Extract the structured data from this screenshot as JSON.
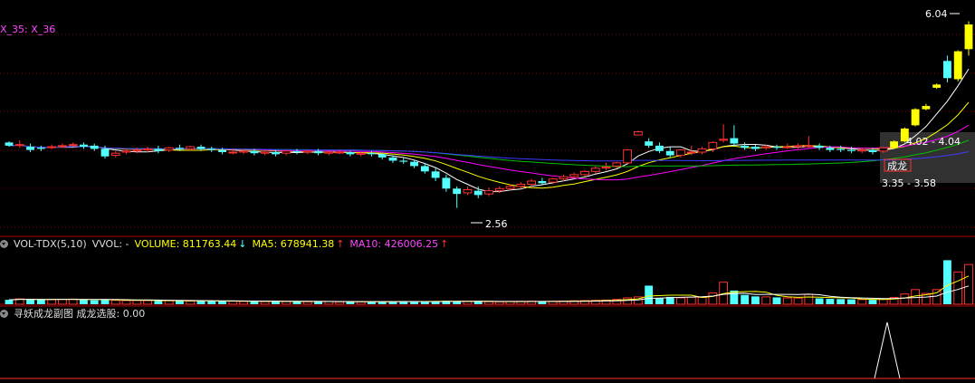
{
  "colors": {
    "background": "#000000",
    "up": "#ff3232",
    "down": "#54ffff",
    "ma_yellow": "#ffff00",
    "ma_white": "#ffffff",
    "ma_magenta": "#ff00ff",
    "ma_green": "#00c000",
    "ma_blue": "#3b3bff",
    "grid": "#7a0000",
    "highlight_band": "#505050"
  },
  "main_panel": {
    "legend": "X_35: X_36",
    "annotations": {
      "high_price": "6.04",
      "low_price": "2.56",
      "upper_zone": "4.02 - 4.04",
      "lower_zone": "3.35 - 3.58",
      "signal_label": "成龙"
    }
  },
  "volume_panel": {
    "indicator": "VOL-TDX(5,10)",
    "vvol": "VVOL: -",
    "volume": "VOLUME: 811763.44",
    "volume_arrow": "↓",
    "ma5": "MA5: 678941.38",
    "ma5_arrow": "↑",
    "ma10": "MA10: 426006.25",
    "ma10_arrow": "↑"
  },
  "signal_panel": {
    "title": "寻妖成龙副图 成龙选股: 0.00"
  },
  "chart_data": [
    {
      "type": "candlestick",
      "title": "",
      "ylim": [
        2.3,
        6.2
      ],
      "series": [
        {
          "values": [
            [
              3.78,
              3.8,
              3.72,
              3.7
            ],
            [
              3.74,
              3.82,
              3.74,
              3.68
            ],
            [
              3.7,
              3.76,
              3.64,
              3.6
            ],
            [
              3.68,
              3.72,
              3.66,
              3.62
            ],
            [
              3.7,
              3.74,
              3.7,
              3.66
            ],
            [
              3.72,
              3.76,
              3.72,
              3.68
            ],
            [
              3.74,
              3.78,
              3.74,
              3.7
            ],
            [
              3.74,
              3.78,
              3.7,
              3.66
            ],
            [
              3.72,
              3.76,
              3.66,
              3.62
            ],
            [
              3.66,
              3.72,
              3.52,
              3.48
            ],
            [
              3.54,
              3.62,
              3.58,
              3.5
            ],
            [
              3.6,
              3.66,
              3.62,
              3.56
            ],
            [
              3.62,
              3.68,
              3.64,
              3.58
            ],
            [
              3.64,
              3.7,
              3.66,
              3.6
            ],
            [
              3.66,
              3.72,
              3.62,
              3.58
            ],
            [
              3.64,
              3.7,
              3.68,
              3.6
            ],
            [
              3.68,
              3.74,
              3.66,
              3.62
            ],
            [
              3.66,
              3.72,
              3.7,
              3.62
            ],
            [
              3.7,
              3.74,
              3.66,
              3.62
            ],
            [
              3.66,
              3.7,
              3.64,
              3.6
            ],
            [
              3.64,
              3.68,
              3.6,
              3.56
            ],
            [
              3.6,
              3.66,
              3.6,
              3.56
            ],
            [
              3.6,
              3.64,
              3.62,
              3.56
            ],
            [
              3.62,
              3.66,
              3.58,
              3.54
            ],
            [
              3.58,
              3.62,
              3.6,
              3.54
            ],
            [
              3.6,
              3.64,
              3.56,
              3.52
            ],
            [
              3.58,
              3.64,
              3.62,
              3.54
            ],
            [
              3.62,
              3.66,
              3.6,
              3.56
            ],
            [
              3.6,
              3.64,
              3.62,
              3.56
            ],
            [
              3.62,
              3.66,
              3.58,
              3.54
            ],
            [
              3.58,
              3.62,
              3.6,
              3.54
            ],
            [
              3.6,
              3.64,
              3.6,
              3.56
            ],
            [
              3.6,
              3.62,
              3.56,
              3.52
            ],
            [
              3.56,
              3.6,
              3.58,
              3.52
            ],
            [
              3.58,
              3.62,
              3.56,
              3.52
            ],
            [
              3.56,
              3.58,
              3.5,
              3.46
            ],
            [
              3.5,
              3.54,
              3.44,
              3.4
            ],
            [
              3.44,
              3.5,
              3.42,
              3.38
            ],
            [
              3.42,
              3.46,
              3.34,
              3.3
            ],
            [
              3.34,
              3.4,
              3.24,
              3.2
            ],
            [
              3.24,
              3.3,
              3.12,
              3.06
            ],
            [
              3.12,
              3.18,
              2.92,
              2.86
            ],
            [
              2.92,
              2.96,
              2.82,
              2.56
            ],
            [
              2.84,
              2.96,
              2.9,
              2.8
            ],
            [
              2.88,
              2.96,
              2.8,
              2.74
            ],
            [
              2.82,
              2.94,
              2.88,
              2.78
            ],
            [
              2.88,
              2.96,
              2.92,
              2.84
            ],
            [
              2.92,
              3.0,
              2.96,
              2.88
            ],
            [
              2.96,
              3.04,
              3.0,
              2.92
            ],
            [
              3.0,
              3.1,
              3.06,
              2.96
            ],
            [
              3.06,
              3.12,
              3.02,
              2.98
            ],
            [
              3.04,
              3.12,
              3.1,
              3.0
            ],
            [
              3.1,
              3.18,
              3.14,
              3.06
            ],
            [
              3.14,
              3.22,
              3.18,
              3.1
            ],
            [
              3.18,
              3.26,
              3.24,
              3.14
            ],
            [
              3.24,
              3.34,
              3.3,
              3.2
            ],
            [
              3.32,
              3.4,
              3.32,
              3.26
            ],
            [
              3.34,
              3.42,
              3.4,
              3.3
            ],
            [
              3.4,
              3.66,
              3.64,
              3.38
            ],
            [
              3.92,
              4.0,
              3.98,
              3.92
            ],
            [
              3.8,
              3.86,
              3.72,
              3.68
            ],
            [
              3.72,
              3.78,
              3.62,
              3.58
            ],
            [
              3.62,
              3.7,
              3.54,
              3.5
            ],
            [
              3.54,
              3.66,
              3.64,
              3.5
            ],
            [
              3.6,
              3.72,
              3.6,
              3.54
            ],
            [
              3.6,
              3.7,
              3.66,
              3.56
            ],
            [
              3.66,
              3.8,
              3.78,
              3.6
            ],
            [
              3.82,
              4.12,
              3.84,
              3.78
            ],
            [
              3.86,
              4.1,
              3.76,
              3.7
            ],
            [
              3.72,
              3.78,
              3.68,
              3.64
            ],
            [
              3.7,
              3.74,
              3.66,
              3.62
            ],
            [
              3.68,
              3.74,
              3.7,
              3.64
            ],
            [
              3.7,
              3.74,
              3.68,
              3.64
            ],
            [
              3.7,
              3.76,
              3.7,
              3.66
            ],
            [
              3.7,
              3.76,
              3.72,
              3.66
            ],
            [
              3.72,
              3.9,
              3.72,
              3.68
            ],
            [
              3.72,
              3.76,
              3.68,
              3.64
            ],
            [
              3.68,
              3.72,
              3.64,
              3.6
            ],
            [
              3.66,
              3.72,
              3.64,
              3.6
            ],
            [
              3.64,
              3.7,
              3.62,
              3.58
            ],
            [
              3.62,
              3.68,
              3.64,
              3.58
            ],
            [
              3.64,
              3.68,
              3.6,
              3.56
            ],
            [
              3.62,
              3.7,
              3.68,
              3.58
            ],
            [
              3.68,
              3.82,
              3.8,
              3.66
            ],
            [
              3.8,
              4.06,
              4.04,
              3.78
            ],
            [
              4.1,
              4.42,
              4.4,
              4.08
            ],
            [
              4.4,
              4.5,
              4.46,
              4.38
            ],
            [
              4.8,
              4.88,
              4.86,
              4.78
            ],
            [
              5.3,
              5.4,
              4.98,
              4.9
            ],
            [
              4.96,
              5.5,
              5.48,
              4.92
            ],
            [
              5.52,
              6.04,
              5.98,
              5.4
            ]
          ]
        }
      ]
    },
    {
      "type": "bar",
      "title": "VOL-TDX(5,10)",
      "ylim": [
        0,
        1000000
      ],
      "series": [
        {
          "values": [
            90000,
            110000,
            100000,
            95000,
            100000,
            100000,
            105000,
            90000,
            80000,
            95000,
            80000,
            75000,
            78000,
            75000,
            70000,
            72000,
            68000,
            65000,
            70000,
            65000,
            60000,
            62000,
            58000,
            60000,
            55000,
            58000,
            60000,
            55000,
            52000,
            58000,
            55000,
            50000,
            48000,
            52000,
            50000,
            55000,
            58000,
            60000,
            55000,
            52000,
            60000,
            70000,
            62000,
            58000,
            55000,
            52000,
            50000,
            55000,
            58000,
            62000,
            55000,
            60000,
            65000,
            70000,
            75000,
            80000,
            85000,
            100000,
            130000,
            150000,
            380000,
            120000,
            150000,
            130000,
            145000,
            140000,
            230000,
            450000,
            280000,
            190000,
            160000,
            150000,
            140000,
            130000,
            125000,
            200000,
            120000,
            110000,
            105000,
            100000,
            95000,
            90000,
            100000,
            140000,
            210000,
            300000,
            220000,
            300000,
            900000,
            660000,
            811763
          ]
        }
      ]
    }
  ]
}
